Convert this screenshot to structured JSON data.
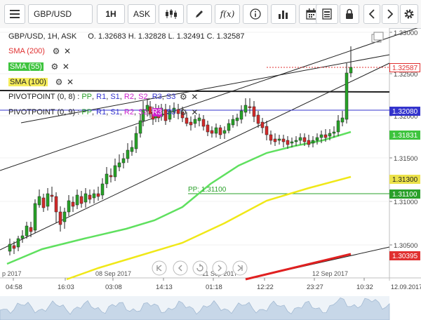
{
  "toolbar": {
    "menu_icon": "hamburger-icon",
    "symbol": "GBP/USD",
    "timeframe": "1H",
    "price_side": "ASK",
    "fx_label": "f(x)"
  },
  "header": {
    "title": "GBP/USD, 1H, ASK",
    "ohlc": "O. 1.32683 H. 1.32828 L. 1.32491 C. 1.32587"
  },
  "indicators": [
    {
      "label": "SMA (200)",
      "color": "#e03030"
    },
    {
      "label": "SMA (55)",
      "color": "#3ec43e"
    },
    {
      "label": "SMA (100)",
      "color": "#d8c800"
    }
  ],
  "pivots": [
    {
      "prefix": "PIVOTPOINT (0, 8)",
      "items": [
        "PP",
        "R1",
        "S1",
        "R2",
        "S2",
        "R3",
        "S3"
      ]
    },
    {
      "prefix": "PIVOTPOINT (0, 9)",
      "items": [
        "PP",
        "R1",
        "S1",
        "R2",
        "S2",
        "R3",
        "S3"
      ]
    }
  ],
  "pivot_annotation": "PP: 1.31100",
  "y_axis": {
    "ticks": [
      "1.33000",
      "1.32500",
      "1.32000",
      "1.31500",
      "1.31000",
      "1.30500"
    ]
  },
  "price_tags": [
    {
      "value": "1.32587",
      "bg": "#ffffff",
      "fg": "#e03030",
      "border": "#e03030"
    },
    {
      "value": "1.32080",
      "bg": "#3333cc",
      "fg": "#ffffff",
      "border": "#3333cc"
    },
    {
      "value": "1.31831",
      "bg": "#3ec43e",
      "fg": "#ffffff",
      "border": "#3ec43e"
    },
    {
      "value": "1.31300",
      "bg": "#ece24a",
      "fg": "#222222",
      "border": "#ece24a"
    },
    {
      "value": "1.31100",
      "bg": "#2aa02a",
      "fg": "#ffffff",
      "border": "#2aa02a"
    },
    {
      "value": "1.30395",
      "bg": "#e03030",
      "fg": "#ffffff",
      "border": "#e03030"
    }
  ],
  "x_axis": {
    "times": [
      "04:58",
      "16:03",
      "03:08",
      "14:13",
      "01:18",
      "12:22",
      "23:27",
      "10:32"
    ],
    "dates": [
      "p 2017",
      "08 Sep 2017",
      "11 Sep 2017",
      "12 Sep 2017"
    ],
    "end_date": "12.09.2017"
  },
  "nav_icons": [
    "first-icon",
    "prev-icon",
    "reset-icon",
    "next-icon",
    "last-icon"
  ],
  "colors": {
    "up_candle": "#27a327",
    "down_candle": "#d42a2a"
  }
}
